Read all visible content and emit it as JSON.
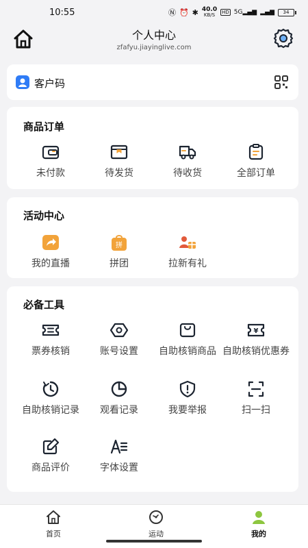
{
  "status_bar": {
    "time": "10:55",
    "net_speed_value": "40.0",
    "net_speed_unit": "KB/S",
    "hd_badge": "HD",
    "signal_label": "5G",
    "battery": "34"
  },
  "header": {
    "title": "个人中心",
    "url": "zfafyu.jiayinglive.com"
  },
  "customer_code": {
    "label": "客户码"
  },
  "orders": {
    "title": "商品订单",
    "items": [
      {
        "label": "未付款",
        "icon": "wallet-icon"
      },
      {
        "label": "待发货",
        "icon": "package-icon"
      },
      {
        "label": "待收货",
        "icon": "truck-icon"
      },
      {
        "label": "全部订单",
        "icon": "clipboard-icon"
      }
    ]
  },
  "activity": {
    "title": "活动中心",
    "items": [
      {
        "label": "我的直播",
        "icon": "live-share-icon"
      },
      {
        "label": "拼团",
        "icon": "group-buy-bag-icon",
        "badge": "拼"
      },
      {
        "label": "拉新有礼",
        "icon": "invite-gift-icon"
      }
    ]
  },
  "tools": {
    "title": "必备工具",
    "items": [
      {
        "label": "票券核销",
        "icon": "ticket-icon"
      },
      {
        "label": "账号设置",
        "icon": "account-settings-icon"
      },
      {
        "label": "自助核销商品",
        "icon": "self-verify-goods-icon"
      },
      {
        "label": "自助核销优惠券",
        "icon": "coupon-icon",
        "badge": "¥"
      },
      {
        "label": "自助核销记录",
        "icon": "history-icon"
      },
      {
        "label": "观看记录",
        "icon": "pie-chart-icon"
      },
      {
        "label": "我要举报",
        "icon": "report-icon"
      },
      {
        "label": "扫一扫",
        "icon": "scan-icon"
      },
      {
        "label": "商品评价",
        "icon": "edit-review-icon"
      },
      {
        "label": "字体设置",
        "icon": "font-settings-icon"
      }
    ]
  },
  "bottom_nav": {
    "items": [
      {
        "label": "首页",
        "icon": "home-icon"
      },
      {
        "label": "运动",
        "icon": "sport-icon"
      },
      {
        "label": "我的",
        "icon": "profile-icon",
        "active": true
      }
    ]
  },
  "colors": {
    "accent_orange": "#f2a33a",
    "accent_green": "#8dc63f",
    "accent_blue": "#2f7cf6",
    "icon_dark": "#1c2430"
  }
}
